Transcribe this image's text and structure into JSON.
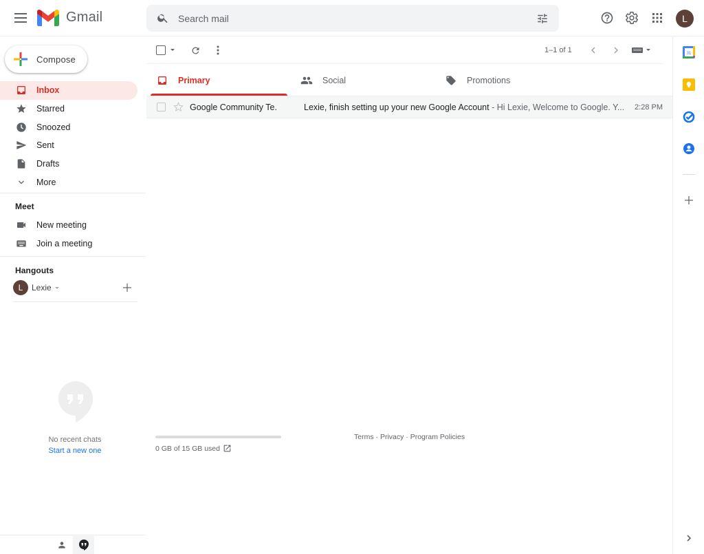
{
  "header": {
    "app_name": "Gmail",
    "search_placeholder": "Search mail",
    "avatar_initial": "L",
    "icons": [
      "menu-icon",
      "gmail-logo",
      "search-icon",
      "tune-icon",
      "help-icon",
      "settings-icon",
      "apps-icon"
    ]
  },
  "compose": {
    "label": "Compose"
  },
  "nav": {
    "items": [
      {
        "label": "Inbox",
        "icon": "inbox-icon",
        "active": true
      },
      {
        "label": "Starred",
        "icon": "star-icon"
      },
      {
        "label": "Snoozed",
        "icon": "clock-icon"
      },
      {
        "label": "Sent",
        "icon": "send-icon"
      },
      {
        "label": "Drafts",
        "icon": "draft-icon"
      },
      {
        "label": "More",
        "icon": "chevron-down-icon"
      }
    ]
  },
  "meet": {
    "title": "Meet",
    "items": [
      {
        "label": "New meeting",
        "icon": "videocam-icon"
      },
      {
        "label": "Join a meeting",
        "icon": "keyboard-icon"
      }
    ]
  },
  "hangouts": {
    "title": "Hangouts",
    "user_initial": "L",
    "user_name": "Lexie",
    "no_chats": "No recent chats",
    "start_new": "Start a new one"
  },
  "toolbar": {
    "pagination": "1–1 of 1"
  },
  "tabs": [
    {
      "label": "Primary",
      "icon": "inbox-icon",
      "active": true
    },
    {
      "label": "Social",
      "icon": "people-icon"
    },
    {
      "label": "Promotions",
      "icon": "tag-icon"
    }
  ],
  "emails": [
    {
      "sender": "Google Community Te.",
      "subject": "Lexie, finish setting up your new Google Account",
      "snippet": " - Hi Lexie, Welcome to Google. Y...",
      "time": "2:28 PM",
      "starred": false
    }
  ],
  "storage": {
    "used_fraction": 0,
    "text": "0 GB of 15 GB used"
  },
  "footer": {
    "links": [
      "Terms",
      "Privacy",
      "Program Policies"
    ],
    "separator": " · "
  },
  "side_panel": {
    "apps": [
      "calendar-icon",
      "keep-icon",
      "tasks-icon",
      "contacts-icon"
    ]
  },
  "colors": {
    "accent": "#d93025",
    "active_bg": "#fce8e6",
    "link": "#1a73e8",
    "avatar": "#5d4037"
  }
}
